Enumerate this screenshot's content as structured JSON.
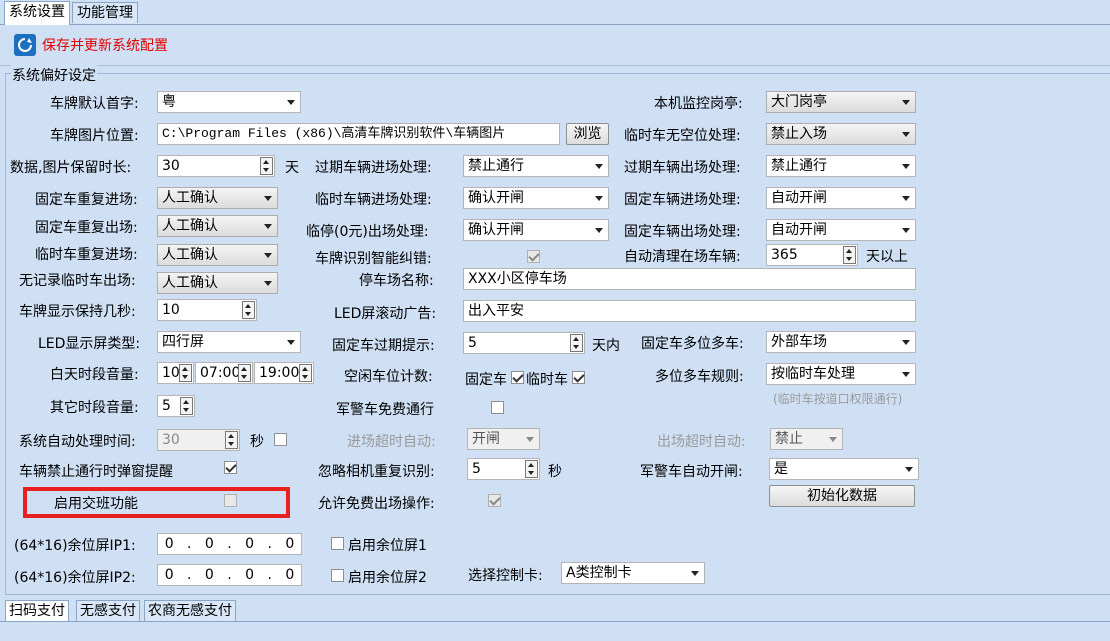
{
  "tabs": [
    "系统设置",
    "功能管理"
  ],
  "toolbar": {
    "save_label": "保存并更新系统配置"
  },
  "group_title": "系统偏好设定",
  "rows": {
    "plate_prefix": {
      "label": "车牌默认首字:",
      "value": "粤"
    },
    "station": {
      "label": "本机监控岗亭:",
      "value": "大门岗亭"
    },
    "image_path": {
      "label": "车牌图片位置:",
      "value": "C:\\Program Files (x86)\\高清车牌识别软件\\车辆图片",
      "browse": "浏览"
    },
    "temp_no_space": {
      "label": "临时车无空位处理:",
      "value": "禁止入场"
    },
    "retention": {
      "label": "数据,图片保留时长:",
      "value": "30",
      "unit": "天"
    },
    "expired_in": {
      "label": "过期车辆进场处理:",
      "value": "禁止通行"
    },
    "expired_out": {
      "label": "过期车辆出场处理:",
      "value": "禁止通行"
    },
    "fixed_dup_in": {
      "label": "固定车重复进场:",
      "value": "人工确认"
    },
    "temp_in": {
      "label": "临时车辆进场处理:",
      "value": "确认开闸"
    },
    "fixed_in": {
      "label": "固定车辆进场处理:",
      "value": "自动开闸"
    },
    "fixed_dup_out": {
      "label": "固定车重复出场:",
      "value": "人工确认"
    },
    "temp_zero_out": {
      "label": "临停(0元)出场处理:",
      "value": "确认开闸"
    },
    "fixed_out": {
      "label": "固定车辆出场处理:",
      "value": "自动开闸"
    },
    "temp_dup_in": {
      "label": "临时车重复进场:",
      "value": "人工确认"
    },
    "smart_correct": {
      "label": "车牌识别智能纠错:"
    },
    "auto_clean": {
      "label": "自动清理在场车辆:",
      "value": "365",
      "unit": "天以上"
    },
    "no_record_out": {
      "label": "无记录临时车出场:",
      "value": "人工确认"
    },
    "park_name": {
      "label": "停车场名称:",
      "value": "XXX小区停车场"
    },
    "plate_hold": {
      "label": "车牌显示保持几秒:",
      "value": "10"
    },
    "led_ad": {
      "label": "LED屏滚动广告:",
      "value": "出入平安"
    },
    "led_type": {
      "label": "LED显示屏类型:",
      "value": "四行屏"
    },
    "fixed_expire_tip": {
      "label": "固定车过期提示:",
      "value": "5",
      "unit": "天内"
    },
    "fixed_multi": {
      "label": "固定车多位多车:",
      "value": "外部车场"
    },
    "day_volume": {
      "label": "白天时段音量:",
      "volume": "10",
      "start": "07:00",
      "end": "19:00"
    },
    "free_count": {
      "label": "空闲车位计数:",
      "fixed": "固定车",
      "temp": "临时车"
    },
    "multi_rule": {
      "label": "多位多车规则:",
      "value": "按临时车处理",
      "note": "(临时车按道口权限通行)"
    },
    "other_volume": {
      "label": "其它时段音量:",
      "value": "5"
    },
    "military_free": {
      "label": "军警车免费通行"
    },
    "auto_time": {
      "label": "系统自动处理时间:",
      "value": "30",
      "unit": "秒"
    },
    "timeout_in": {
      "label": "进场超时自动:",
      "value": "开闸"
    },
    "timeout_out": {
      "label": "出场超时自动:",
      "value": "禁止"
    },
    "ban_popup": {
      "label": "车辆禁止通行时弹窗提醒"
    },
    "ignore_dup": {
      "label": "忽略相机重复识别:",
      "value": "5",
      "unit": "秒"
    },
    "military_auto": {
      "label": "军警车自动开闸:",
      "value": "是"
    },
    "shift": {
      "label": "启用交班功能"
    },
    "free_exit": {
      "label": "允许免费出场操作:"
    },
    "init_data": {
      "label": "初始化数据"
    },
    "screen1": {
      "label": "(64*16)余位屏IP1:",
      "ip": [
        "0",
        "0",
        "0",
        "0"
      ],
      "enable": "启用余位屏1"
    },
    "screen2": {
      "label": "(64*16)余位屏IP2:",
      "ip": [
        "0",
        "0",
        "0",
        "0"
      ],
      "enable": "启用余位屏2"
    },
    "control_card": {
      "label": "选择控制卡:",
      "value": "A类控制卡"
    }
  },
  "bottom_tabs": [
    "扫码支付",
    "无感支付",
    "农商无感支付"
  ],
  "colors": {
    "background": "#cfe0f5",
    "save_text": "#e00000",
    "highlight": "#e82020"
  }
}
